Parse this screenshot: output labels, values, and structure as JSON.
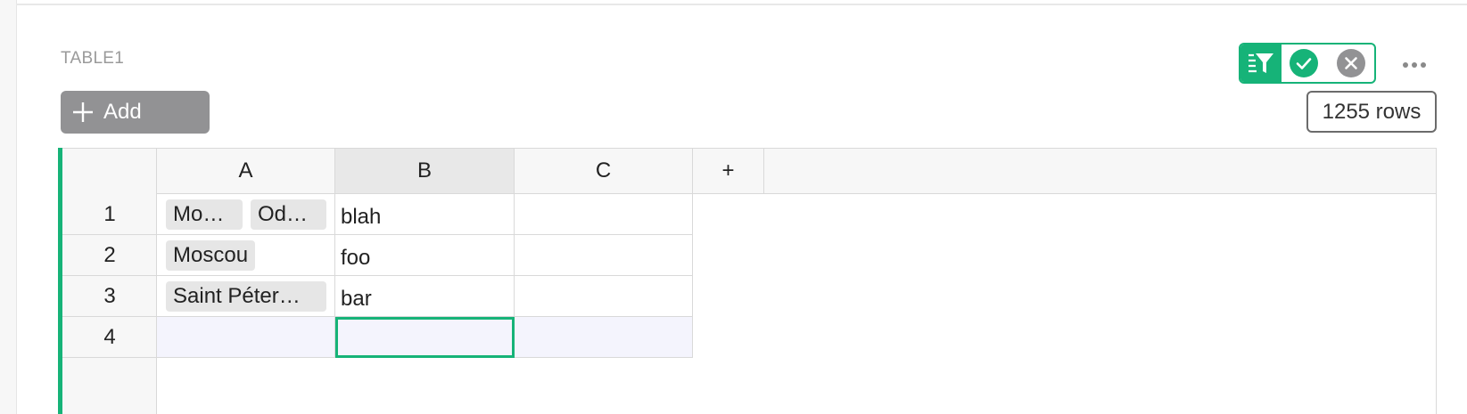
{
  "section": {
    "title": "TABLE1"
  },
  "toolbar": {
    "add_filter_label": "Add",
    "row_count": "1255 rows"
  },
  "icons": {
    "filter_toggle": "filter-lines-icon",
    "save": "checkmark-icon",
    "revert": "close-icon",
    "more": "ellipsis-icon",
    "add": "plus-icon"
  },
  "colors": {
    "accent": "#16b378",
    "muted_button": "#929294",
    "add_row_bg": "#f4f4fd"
  },
  "grid": {
    "columns": [
      "A",
      "B",
      "C"
    ],
    "add_column_label": "+",
    "rows": [
      {
        "num": "1",
        "a_chips": [
          "Mo…",
          "Od…"
        ],
        "b": "blah",
        "c": ""
      },
      {
        "num": "2",
        "a_chips": [
          "Moscou"
        ],
        "b": "foo",
        "c": ""
      },
      {
        "num": "3",
        "a_chips": [
          "Saint Péter…"
        ],
        "b": "bar",
        "c": ""
      }
    ],
    "add_row_num": "4"
  }
}
